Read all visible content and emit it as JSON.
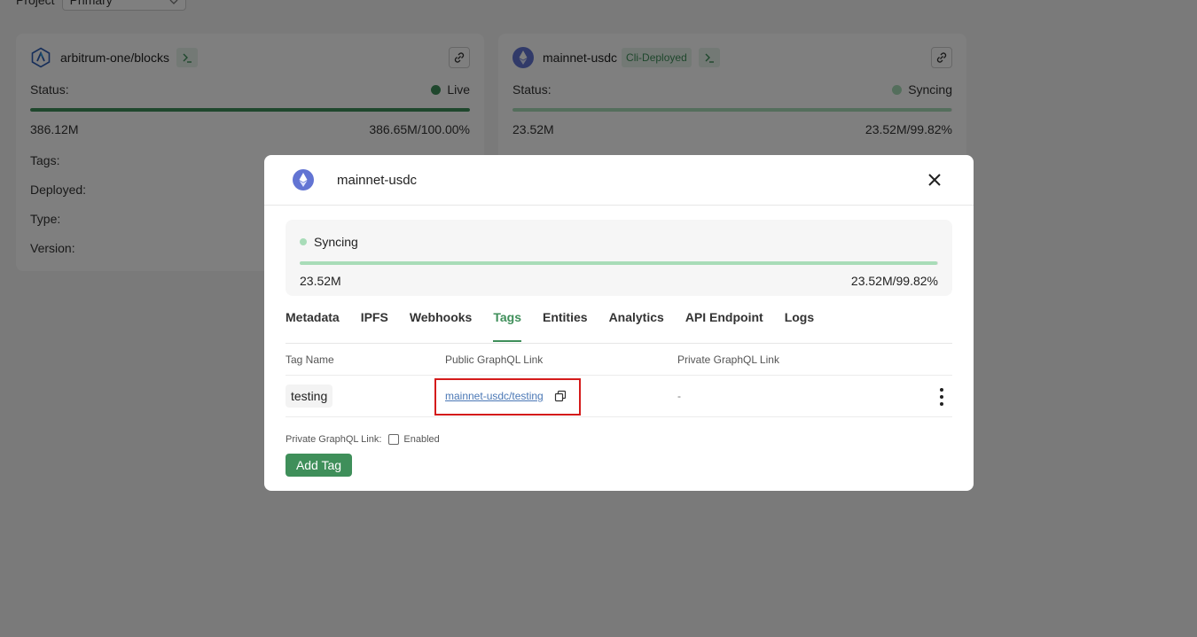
{
  "project": {
    "label": "Project",
    "selected": "Primary"
  },
  "cards": [
    {
      "title": "arbitrum-one/blocks",
      "status_label": "Status:",
      "status_value": "Live",
      "status_color": "#3f8f5a",
      "progress": 1.0,
      "left_num": "386.12M",
      "right_num": "386.65M/100.00%",
      "fields": [
        "Tags:",
        "Deployed:",
        "Type:",
        "Version:"
      ]
    },
    {
      "title": "mainnet-usdc",
      "badge": "Cli-Deployed",
      "status_label": "Status:",
      "status_value": "Syncing",
      "status_color": "#a8dcb8",
      "progress": 0.9982,
      "left_num": "23.52M",
      "right_num": "23.52M/99.82%"
    }
  ],
  "modal": {
    "title": "mainnet-usdc",
    "sync": {
      "status": "Syncing",
      "dot_color": "#a8dcb8",
      "progress": 0.9982,
      "left_num": "23.52M",
      "right_num": "23.52M/99.82%"
    },
    "tabs": [
      "Metadata",
      "IPFS",
      "Webhooks",
      "Tags",
      "Entities",
      "Analytics",
      "API Endpoint",
      "Logs"
    ],
    "active_tab": "Tags",
    "table": {
      "headers": [
        "Tag Name",
        "Public GraphQL Link",
        "Private GraphQL Link"
      ],
      "rows": [
        {
          "tag": "testing",
          "public_link": "mainnet-usdc/testing",
          "private_link": "-"
        }
      ]
    },
    "private_label": "Private GraphQL Link:",
    "enabled_label": "Enabled",
    "add_button": "Add Tag"
  },
  "colors": {
    "accent": "#3f8f5a",
    "highlight": "#d41b1b",
    "link": "#4a77b5"
  }
}
